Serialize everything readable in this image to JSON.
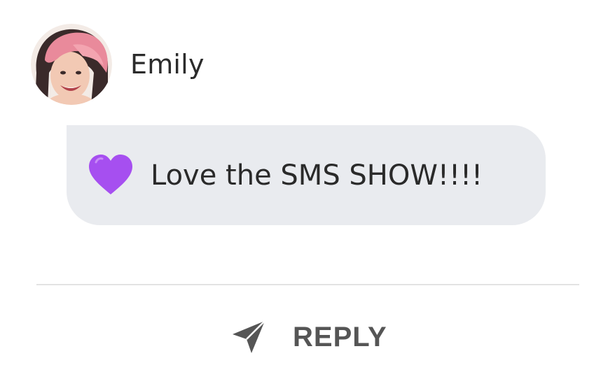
{
  "message": {
    "sender_name": "Emily",
    "emoji_icon": "purple-heart-icon",
    "text": "Love the SMS SHOW!!!!"
  },
  "actions": {
    "reply_icon": "send-arrow-icon",
    "reply_label": "REPLY"
  },
  "colors": {
    "bubble_background": "#e9ebef",
    "heart": "#a64ff0",
    "reply_text": "#555555",
    "divider": "#e3e3e3"
  }
}
